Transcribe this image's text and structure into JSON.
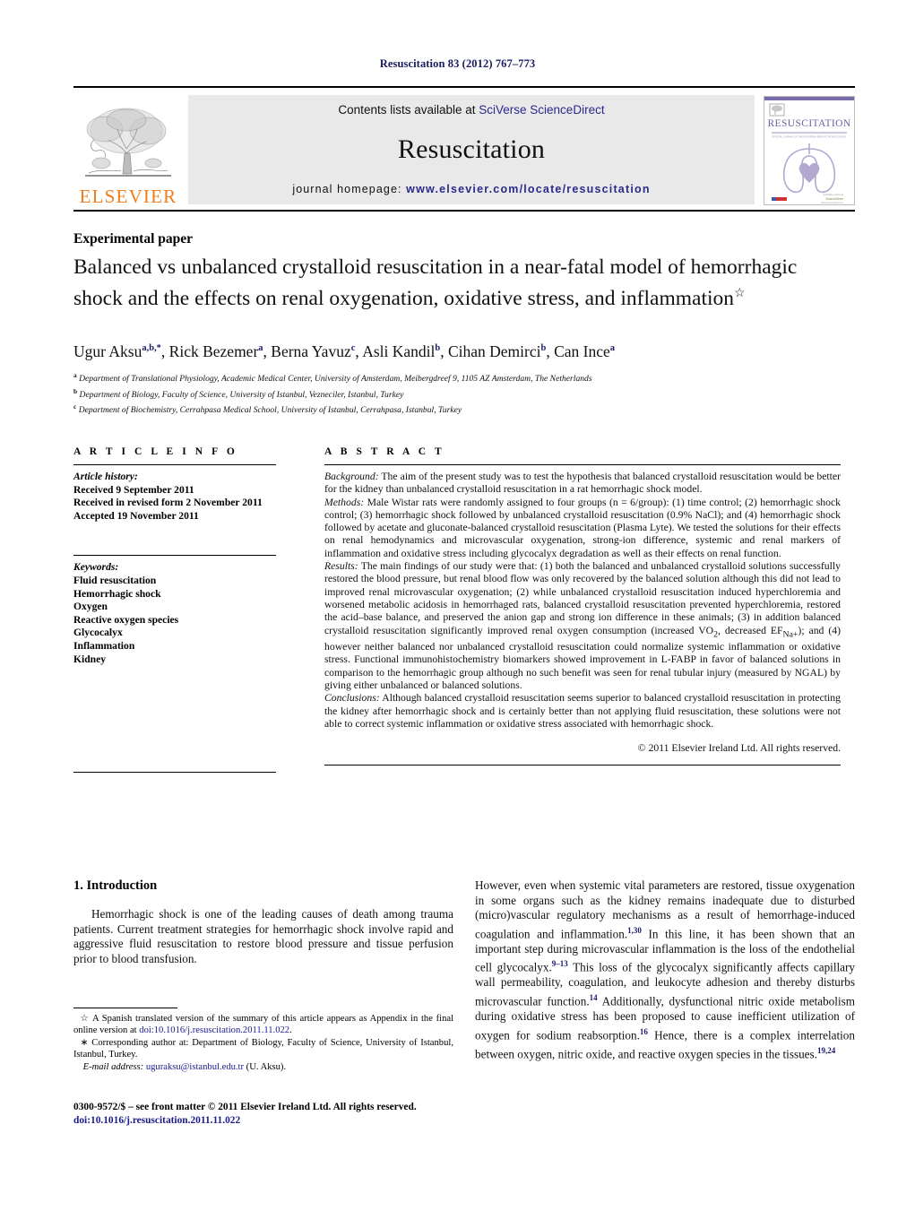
{
  "running_head": "Resuscitation 83 (2012) 767–773",
  "masthead": {
    "publisher_name": "ELSEVIER",
    "contents_prefix": "Contents lists available at ",
    "contents_link": "SciVerse ScienceDirect",
    "journal_name": "Resuscitation",
    "homepage_prefix": "journal homepage: ",
    "homepage_url": "www.elsevier.com/locate/resuscitation",
    "cover_title": "RESUSCITATION",
    "cover_subtitle": "OFFICIAL JOURNAL OF THE EUROPEAN RESUSCITATION COUNCIL",
    "link_color": "#2a2a8c",
    "brand_color": "#f07c1b",
    "cover_accent": "#9a8cbf"
  },
  "article": {
    "type_label": "Experimental paper",
    "title": "Balanced vs unbalanced crystalloid resuscitation in a near-fatal model of hemorrhagic shock and the effects on renal oxygenation, oxidative stress, and inflammation",
    "title_marker": "☆",
    "authors": [
      {
        "name": "Ugur Aksu",
        "sup": "a,b,*"
      },
      {
        "name": "Rick Bezemer",
        "sup": "a"
      },
      {
        "name": "Berna Yavuz",
        "sup": "c"
      },
      {
        "name": "Asli Kandil",
        "sup": "b"
      },
      {
        "name": "Cihan Demirci",
        "sup": "b"
      },
      {
        "name": "Can Ince",
        "sup": "a"
      }
    ],
    "affiliations": [
      {
        "marker": "a",
        "text": "Department of Translational Physiology, Academic Medical Center, University of Amsterdam, Meibergdreef 9, 1105 AZ Amsterdam, The Netherlands"
      },
      {
        "marker": "b",
        "text": "Department of Biology, Faculty of Science, University of Istanbul, Vezneciler, Istanbul, Turkey"
      },
      {
        "marker": "c",
        "text": "Department of Biochemistry, Cerrahpasa Medical School, University of Istanbul, Cerrahpasa, Istanbul, Turkey"
      }
    ]
  },
  "article_info": {
    "heading": "A R T I C L E   I N F O",
    "history_label": "Article history:",
    "history": [
      "Received 9 September 2011",
      "Received in revised form 2 November 2011",
      "Accepted 19 November 2011"
    ],
    "keywords_label": "Keywords:",
    "keywords": [
      "Fluid resuscitation",
      "Hemorrhagic shock",
      "Oxygen",
      "Reactive oxygen species",
      "Glycocalyx",
      "Inflammation",
      "Kidney"
    ]
  },
  "abstract": {
    "heading": "A B S T R A C T",
    "background_label": "Background:",
    "background_text": " The aim of the present study was to test the hypothesis that balanced crystalloid resuscitation would be better for the kidney than unbalanced crystalloid resuscitation in a rat hemorrhagic shock model.",
    "methods_label": "Methods:",
    "methods_text": " Male Wistar rats were randomly assigned to four groups (n = 6/group): (1) time control; (2) hemorrhagic shock control; (3) hemorrhagic shock followed by unbalanced crystalloid resuscitation (0.9% NaCl); and (4) hemorrhagic shock followed by acetate and gluconate-balanced crystalloid resuscitation (Plasma Lyte). We tested the solutions for their effects on renal hemodynamics and microvascular oxygenation, strong-ion difference, systemic and renal markers of inflammation and oxidative stress including glycocalyx degradation as well as their effects on renal function.",
    "results_label": "Results:",
    "results_text_1": " The main findings of our study were that: (1) both the balanced and unbalanced crystalloid solutions successfully restored the blood pressure, but renal blood flow was only recovered by the balanced solution although this did not lead to improved renal microvascular oxygenation; (2) while unbalanced crystalloid resuscitation induced hyperchloremia and worsened metabolic acidosis in hemorrhaged rats, balanced crystalloid resuscitation prevented hyperchloremia, restored the acid–base balance, and preserved the anion gap and strong ion difference in these animals; (3) in addition balanced crystalloid resuscitation significantly improved renal oxygen consumption (increased VO",
    "results_sub_1": "2",
    "results_text_2": ", decreased EF",
    "results_sub_2": "Na+",
    "results_text_3": "); and (4) however neither balanced nor unbalanced crystalloid resuscitation could normalize systemic inflammation or oxidative stress. Functional immunohistochemistry biomarkers showed improvement in L-FABP in favor of balanced solutions in comparison to the hemorrhagic group although no such benefit was seen for renal tubular injury (measured by NGAL) by giving either unbalanced or balanced solutions.",
    "conclusions_label": "Conclusions:",
    "conclusions_text": " Although balanced crystalloid resuscitation seems superior to balanced crystalloid resuscitation in protecting the kidney after hemorrhagic shock and is certainly better than not applying fluid resuscitation, these solutions were not able to correct systemic inflammation or oxidative stress associated with hemorrhagic shock.",
    "copyright": "© 2011 Elsevier Ireland Ltd. All rights reserved."
  },
  "introduction": {
    "heading": "1.  Introduction",
    "left_paragraph": "Hemorrhagic shock is one of the leading causes of death among trauma patients. Current treatment strategies for hemorrhagic shock involve rapid and aggressive fluid resuscitation to restore blood pressure and tissue perfusion prior to blood transfusion.",
    "right_p1_a": "However, even when systemic vital parameters are restored, tissue oxygenation in some organs such as the kidney remains inadequate due to disturbed (micro)vascular regulatory mechanisms as a result of hemorrhage-induced coagulation and inflammation.",
    "right_cite_1": "1,30",
    "right_p1_b": " In this line, it has been shown that an important step during microvascular inflammation is the loss of the endothelial cell glycocalyx.",
    "right_cite_2": "9–13",
    "right_p1_c": " This loss of the glycocalyx significantly affects capillary wall permeability, coagulation, and leukocyte adhesion and thereby disturbs microvascular function.",
    "right_cite_3": "14",
    "right_p1_d": " Additionally, dysfunctional nitric oxide metabolism during oxidative stress has been proposed to cause inefficient utilization of oxygen for sodium reabsorption.",
    "right_cite_4": "16",
    "right_p1_e": " Hence, there is a complex interrelation between oxygen, nitric oxide, and reactive oxygen species in the tissues.",
    "right_cite_5": "19,24"
  },
  "footnotes": {
    "star_marker": "☆",
    "star_text_a": " A Spanish translated version of the summary of this article appears as Appendix in the final online version at ",
    "star_doi": "doi:10.1016/j.resuscitation.2011.11.022",
    "star_text_b": ".",
    "corresponding_marker": "∗",
    "corresponding_text": " Corresponding author at: Department of Biology, Faculty of Science, University of Istanbul, Istanbul, Turkey.",
    "email_label": "E-mail address:",
    "email": "uguraksu@istanbul.edu.tr",
    "email_owner": " (U. Aksu).",
    "issn_line": "0300-9572/$ – see front matter © 2011 Elsevier Ireland Ltd. All rights reserved.",
    "doi_label": "doi:",
    "doi_value": "10.1016/j.resuscitation.2011.11.022"
  }
}
